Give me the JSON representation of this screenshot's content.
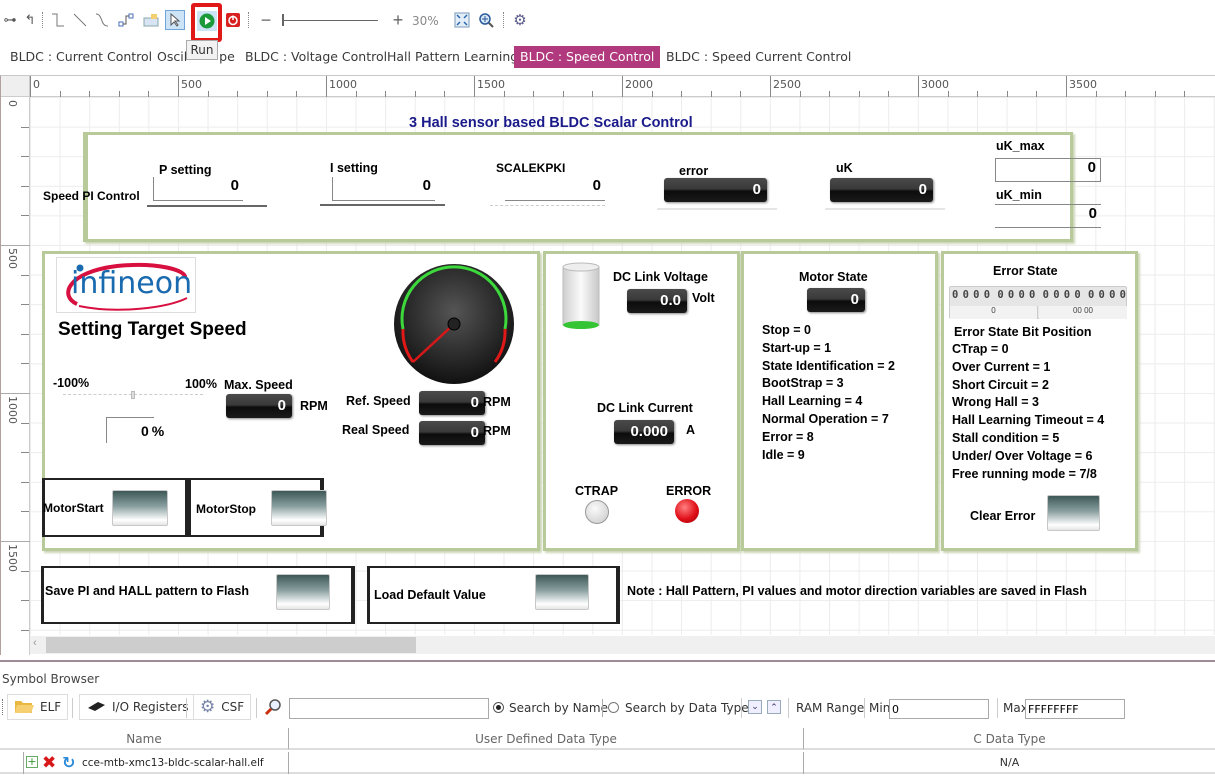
{
  "toolbar": {
    "zoom_level": "30%",
    "run_tooltip": "Run",
    "icons": [
      "connector-icon",
      "connector-step-icon",
      "line-orthogonal-icon",
      "line-straight-icon",
      "line-curve-icon",
      "connector-bend-icon",
      "image-widget-icon",
      "pointer-icon",
      "run-icon",
      "stop-icon",
      "zoom-out-icon",
      "zoom-slider",
      "zoom-in-icon",
      "fit-to-window-icon",
      "zoom-magnify-icon",
      "settings-icon"
    ]
  },
  "tabs": [
    {
      "label": "BLDC : Current  Control",
      "active": false
    },
    {
      "label": "Oscilloscope",
      "active": false
    },
    {
      "label": "BLDC : Voltage Control",
      "active": false
    },
    {
      "label": "Hall Pattern Learning",
      "active": false
    },
    {
      "label": "BLDC : Speed Control",
      "active": true
    },
    {
      "label": "BLDC : Speed Current Control",
      "active": false
    }
  ],
  "tab_visible_text": {
    "oscilloscope_left": "Oscil",
    "oscilloscope_right": "pe"
  },
  "rulers": {
    "horizontal": [
      "0",
      "500",
      "1000",
      "1500",
      "2000",
      "2500",
      "3000",
      "3500"
    ],
    "vertical": [
      "0",
      "500",
      "1000",
      "1500"
    ]
  },
  "dashboard": {
    "title": "3 Hall sensor based BLDC Scalar Control",
    "speed_pi": {
      "label": "Speed PI Control",
      "p_setting": {
        "label": "P setting",
        "value": "0"
      },
      "i_setting": {
        "label": "I setting",
        "value": "0"
      },
      "scalekpki": {
        "label": "SCALEKPKI",
        "value": "0"
      },
      "error": {
        "label": "error",
        "value": "0"
      },
      "uk": {
        "label": "uK",
        "value": "0"
      },
      "uk_max": {
        "label": "uK_max",
        "value": "0"
      },
      "uk_min": {
        "label": "uK_min",
        "value": "0"
      }
    },
    "target_speed": {
      "logo_text": "infineon",
      "heading": "Setting Target Speed",
      "slider_min_label": "-100%",
      "slider_max_label": "100%",
      "slider_value_pct": 0,
      "percent_value": "0",
      "percent_unit": "%",
      "max_speed_label": "Max. Speed",
      "max_speed_value": "0",
      "max_speed_unit": "RPM",
      "ref_speed_label": "Ref. Speed",
      "ref_speed_value": "0",
      "ref_speed_unit": "RPM",
      "real_speed_label": "Real Speed",
      "real_speed_value": "0",
      "real_speed_unit": "RPM",
      "gauge_value": 0,
      "motor_start_label": "MotorStart",
      "motor_stop_label": "MotorStop"
    },
    "dc_link": {
      "voltage_label": "DC Link Voltage",
      "voltage_value": "0.0",
      "voltage_unit": "Volt",
      "current_label": "DC Link Current",
      "current_value": "0.000",
      "current_unit": "A",
      "ctrap_label": "CTRAP",
      "error_label": "ERROR",
      "ctrap_color": "#d8d8d8",
      "error_color": "#e0101a"
    },
    "motor_state": {
      "label": "Motor State",
      "value": "0",
      "legend": [
        "Stop = 0",
        "Start-up = 1",
        "State Identification = 2",
        "BootStrap = 3",
        "Hall Learning = 4",
        "Normal Operation = 7",
        "Error = 8",
        "Idle = 9"
      ]
    },
    "error_state": {
      "label": "Error State",
      "bits": "0000000000000000",
      "bit_readout_left": "0",
      "bit_readout_right": "00 00",
      "bit_position_title": "Error State Bit Position",
      "legend": [
        "CTrap = 0",
        "Over Current = 1",
        "Short Circuit = 2",
        "Wrong Hall = 3",
        "Hall Learning Timeout = 4",
        "Stall condition = 5",
        "Under/ Over Voltage = 6",
        "Free running mode = 7/8"
      ],
      "clear_label": "Clear Error"
    },
    "save_flash_label": "Save PI and HALL pattern to Flash",
    "load_default_label": "Load Default Value",
    "note": "Note : Hall Pattern,  PI values and motor direction variables are saved in Flash"
  },
  "symbol_browser": {
    "title": "Symbol Browser",
    "buttons": {
      "elf": "ELF",
      "io": "I/O Registers",
      "csf": "CSF"
    },
    "search_value": "",
    "search_by_name": "Search by Name",
    "search_by_type": "Search by Data Type",
    "search_mode": "name",
    "ram_range_label": "RAM Range",
    "min_label": "Min",
    "min_value": "0",
    "max_label": "Max",
    "max_value": "FFFFFFFF",
    "columns": [
      "Name",
      "User Defined Data Type",
      "C Data Type"
    ],
    "rows": [
      {
        "name": "cce-mtb-xmc13-bldc-scalar-hall.elf",
        "user_type": "",
        "c_type": "N/A"
      }
    ]
  }
}
